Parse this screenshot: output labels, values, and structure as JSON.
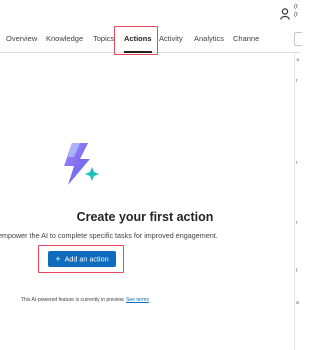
{
  "header": {
    "user_line1": "(r",
    "user_line2": "(r"
  },
  "tabs": [
    {
      "label": "Overview"
    },
    {
      "label": "Knowledge"
    },
    {
      "label": "Topics"
    },
    {
      "label": "Actions",
      "active": true
    },
    {
      "label": "Activity"
    },
    {
      "label": "Analytics"
    },
    {
      "label": "Channe"
    }
  ],
  "right_panel": {
    "close_glyph": "×",
    "side_marks": [
      "r",
      "r",
      "r",
      "t",
      "a"
    ]
  },
  "empty_state": {
    "title": "Create your first action",
    "description": "empower the AI to complete specific tasks for improved engagement.",
    "button_label": "Add an action",
    "button_icon": "plus-icon"
  },
  "footer": {
    "note": "This AI-powered feature is currently in preview.",
    "link": "See terms"
  },
  "colors": {
    "accent": "#0f6cbd",
    "highlight": "#e8485b"
  }
}
